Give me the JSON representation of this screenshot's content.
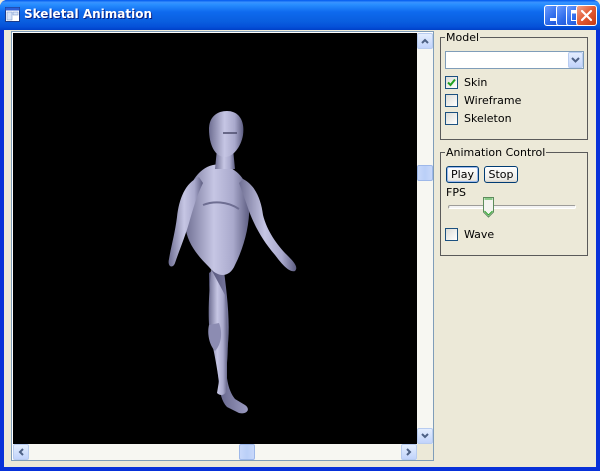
{
  "window": {
    "title": "Skeletal Animation"
  },
  "model_group": {
    "legend": "Model",
    "model_select": {
      "value": ""
    },
    "skin": {
      "label": "Skin",
      "checked": true
    },
    "wireframe": {
      "label": "Wireframe",
      "checked": false
    },
    "skeleton": {
      "label": "Skeleton",
      "checked": false
    }
  },
  "animation_group": {
    "legend": "Animation Control",
    "play_label": "Play",
    "stop_label": "Stop",
    "fps_label": "FPS",
    "fps_slider_fraction": 0.3,
    "wave": {
      "label": "Wave",
      "checked": false
    }
  },
  "scroll": {
    "vertical_fraction": 0.34,
    "horizontal_fraction": 0.55
  },
  "colors": {
    "titlebar": "#0A5FE0",
    "scene_bg": "#000000",
    "figure": "#B8B8D8",
    "accent": "#21A121"
  }
}
